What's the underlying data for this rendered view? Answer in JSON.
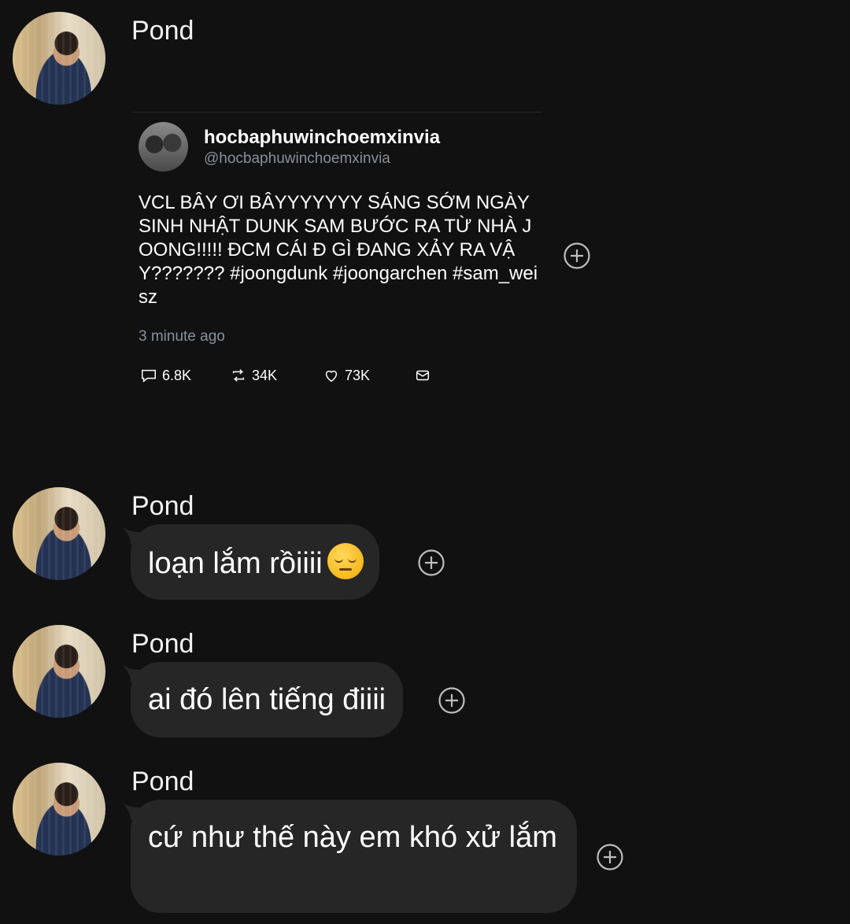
{
  "messages": [
    {
      "sender": "Pond",
      "type": "shared_post",
      "post": {
        "display_name": "hocbaphuwinchoemxinvia",
        "handle": "@hocbaphuwinchoemxinvia",
        "text": "VCL BÂY ƠI BÂYYYYYYY SÁNG SỚM NGÀY SINH NHẬT DUNK SAM BƯỚC RA TỪ NHÀ JOONG!!!!! ĐCM CÁI Đ GÌ ĐANG XẢY RA VẬY??????? #joongdunk #joongarchen #sam_weisz",
        "time": "3 minute ago",
        "stats": {
          "replies": "6.8K",
          "reposts": "34K",
          "likes": "73K"
        }
      }
    },
    {
      "sender": "Pond",
      "type": "text",
      "text": "loạn lắm rồiiii",
      "emoji": "pensive-face"
    },
    {
      "sender": "Pond",
      "type": "text",
      "text": "ai đó lên tiếng điiii"
    },
    {
      "sender": "Pond",
      "type": "text",
      "text": "cứ như thế này em khó xử lắm"
    }
  ],
  "icons": {
    "reaction": "plus-circle-icon",
    "reply": "speech-bubble-icon",
    "repost": "repost-icon",
    "like": "heart-icon",
    "share": "envelope-icon"
  },
  "colors": {
    "background": "#111111",
    "bubble": "#262626",
    "muted_text": "#8a8f98"
  }
}
